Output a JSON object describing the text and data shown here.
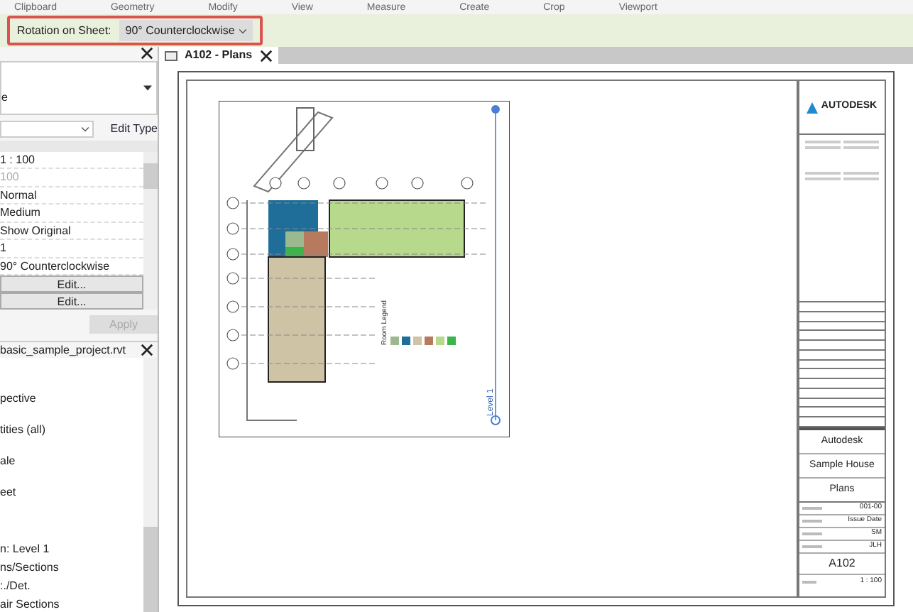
{
  "ribbon": {
    "panels": [
      "Clipboard",
      "Geometry",
      "Modify",
      "View",
      "Measure",
      "Create",
      "Crop",
      "Viewport"
    ]
  },
  "options_bar": {
    "label": "Rotation on Sheet:",
    "value": "90° Counterclockwise"
  },
  "properties": {
    "type_text": "e",
    "edit_type": "Edit Type",
    "rows": [
      {
        "kind": "text",
        "value": "1 : 100",
        "disabled": false
      },
      {
        "kind": "text",
        "value": "100",
        "disabled": true
      },
      {
        "kind": "text",
        "value": "Normal",
        "disabled": false
      },
      {
        "kind": "text",
        "value": "Medium",
        "disabled": false
      },
      {
        "kind": "text",
        "value": "Show Original",
        "disabled": false
      },
      {
        "kind": "text",
        "value": "1",
        "disabled": false
      },
      {
        "kind": "text",
        "value": "90° Counterclockwise",
        "disabled": false
      },
      {
        "kind": "button",
        "value": "Edit...",
        "disabled": false
      },
      {
        "kind": "button",
        "value": "Edit...",
        "disabled": false
      }
    ],
    "apply": "Apply"
  },
  "project_browser": {
    "title": "basic_sample_project.rvt",
    "items": [
      "pective",
      "tities (all)",
      "ale",
      "eet",
      "n: Level 1",
      "ns/Sections",
      ":./Det.",
      "air Sections"
    ]
  },
  "tab": {
    "label": "A102 - Plans"
  },
  "sheet": {
    "logo": "AUTODESK",
    "client": "Autodesk",
    "project": "Sample House",
    "title": "Plans",
    "fields": [
      "001-00",
      "Issue Date",
      "SM",
      "JLH"
    ],
    "number": "A102",
    "scale": "1 : 100",
    "plan": {
      "legend_title": "Room Legend",
      "level": "Level 1",
      "legend": [
        {
          "color": "#9bb98f"
        },
        {
          "color": "#1f6e99"
        },
        {
          "color": "#cfc3a5"
        },
        {
          "color": "#b87a5e"
        },
        {
          "color": "#b7d98b"
        },
        {
          "color": "#3bb54a"
        }
      ]
    }
  }
}
